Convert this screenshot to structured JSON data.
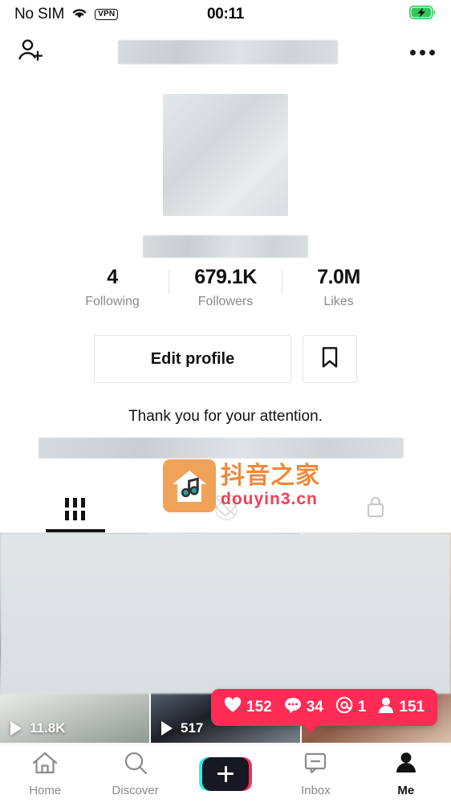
{
  "status_bar": {
    "carrier": "No SIM",
    "wifi_icon": "wifi-icon",
    "vpn_badge": "VPN",
    "time": "00:11",
    "battery_icon": "battery-charging-icon",
    "battery_color": "#34c759"
  },
  "header": {
    "add_friend_icon": "add-person-icon",
    "username_redacted": true,
    "more_icon": "more-options-icon"
  },
  "profile": {
    "avatar_redacted": true,
    "handle_redacted": true,
    "bio": "Thank you for your attention.",
    "bio_link_redacted": true
  },
  "stats": [
    {
      "value": "4",
      "label": "Following"
    },
    {
      "value": "679.1K",
      "label": "Followers"
    },
    {
      "value": "7.0M",
      "label": "Likes"
    }
  ],
  "actions": {
    "edit_profile_label": "Edit profile",
    "bookmark_icon": "bookmark-icon"
  },
  "tabs": [
    {
      "icon": "grid-icon",
      "active": true
    },
    {
      "icon": "heart-icon",
      "active": false
    },
    {
      "icon": "lock-icon",
      "active": false
    }
  ],
  "videos": [
    {
      "views": "11.8K",
      "play_icon": "play-icon"
    },
    {
      "views": "517",
      "play_icon": "play-icon"
    },
    {
      "views": "",
      "play_icon": "play-icon"
    }
  ],
  "toast": {
    "background": "#fe2c55",
    "items": [
      {
        "icon": "heart-icon",
        "count": "152"
      },
      {
        "icon": "comment-icon",
        "count": "34"
      },
      {
        "icon": "mention-icon",
        "count": "1"
      },
      {
        "icon": "follower-icon",
        "count": "151"
      }
    ]
  },
  "bottom_nav": [
    {
      "label": "Home",
      "icon": "home-icon",
      "active": false
    },
    {
      "label": "Discover",
      "icon": "search-icon",
      "active": false
    },
    {
      "label": "",
      "icon": "create-plus-icon",
      "active": false
    },
    {
      "label": "Inbox",
      "icon": "inbox-icon",
      "active": false
    },
    {
      "label": "Me",
      "icon": "person-icon",
      "active": true
    }
  ],
  "watermark": {
    "icon": "house-music-icon",
    "title": "抖音之家",
    "url": "douyin3.cn",
    "title_color": "#f08a3c",
    "url_color": "#ef4056"
  }
}
